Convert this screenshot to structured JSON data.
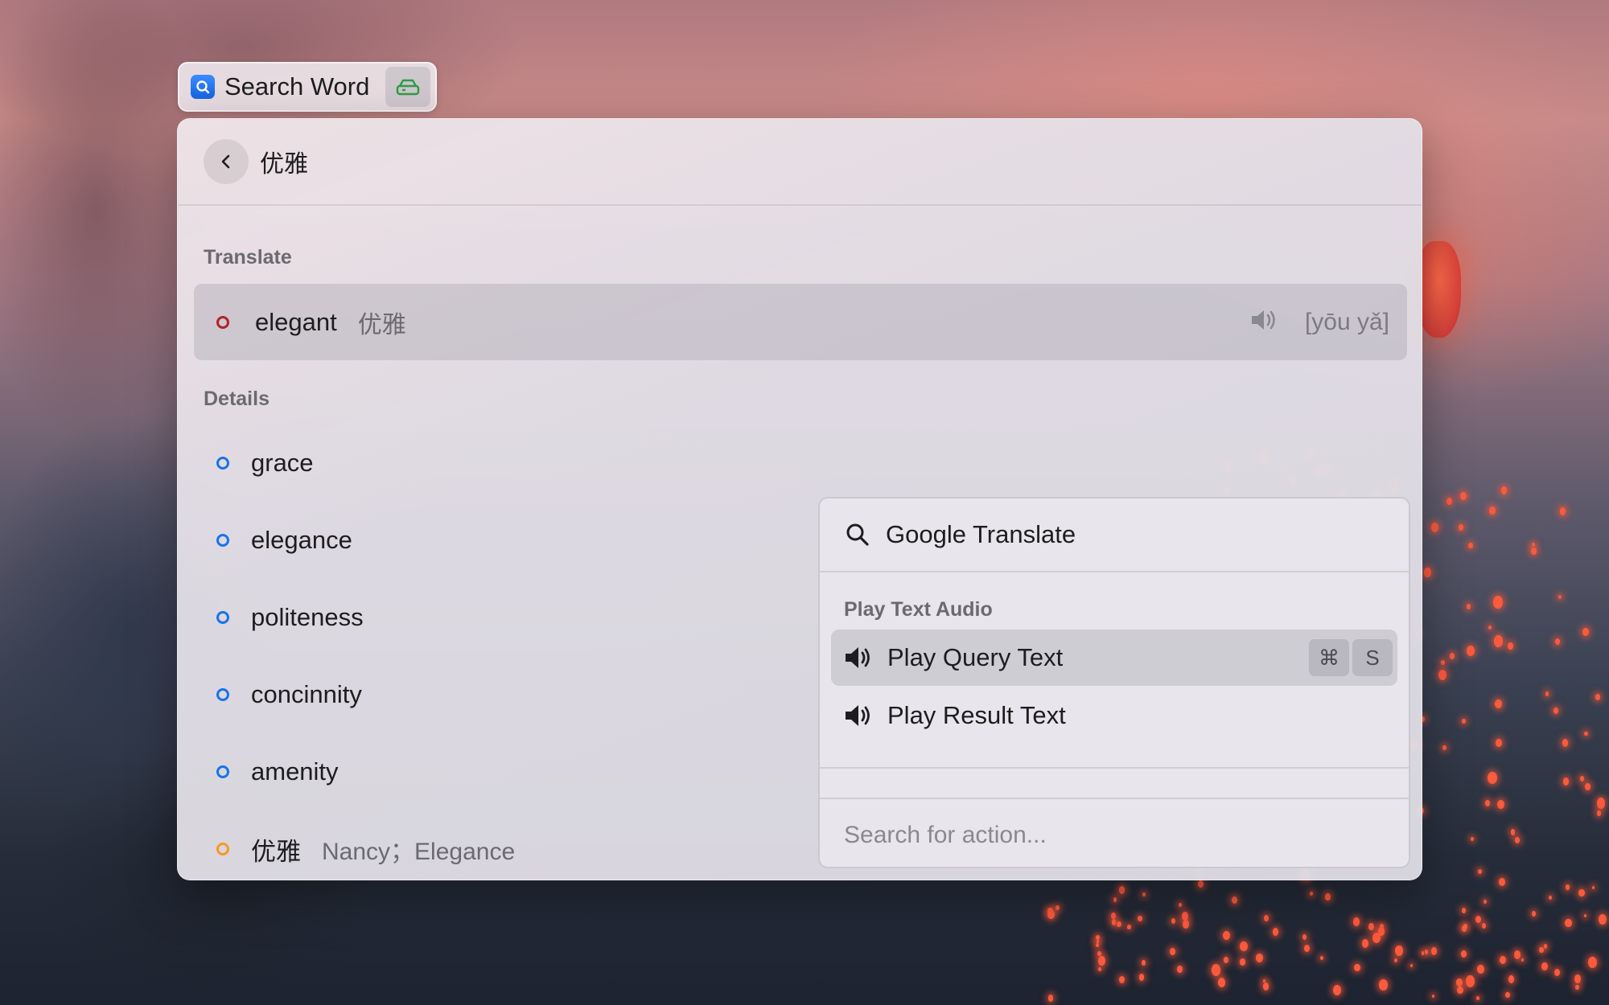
{
  "tag": {
    "app_icon": "magnifier-app-icon",
    "title": "Search Word",
    "disk_icon": "drive-icon"
  },
  "header": {
    "back_icon": "chevron-left-icon",
    "query": "优雅"
  },
  "translate": {
    "section_title": "Translate",
    "word": "elegant",
    "source": "优雅",
    "speaker_icon": "speaker-icon",
    "phonetic": "[yōu yǎ]",
    "dot_color": "#b3212a"
  },
  "details": {
    "section_title": "Details",
    "items": [
      {
        "word": "grace",
        "sub": "",
        "dot_color": "#1a73e8"
      },
      {
        "word": "elegance",
        "sub": "",
        "dot_color": "#1a73e8"
      },
      {
        "word": "politeness",
        "sub": "",
        "dot_color": "#1a73e8"
      },
      {
        "word": "concinnity",
        "sub": "",
        "dot_color": "#1a73e8"
      },
      {
        "word": "amenity",
        "sub": "",
        "dot_color": "#1a73e8"
      },
      {
        "word": "优雅",
        "sub": "Nancy；Elegance",
        "dot_color": "#f29b24"
      }
    ]
  },
  "actions": {
    "top_label": "Google Translate",
    "top_icon": "search-icon",
    "section_title": "Play Text Audio",
    "rows": [
      {
        "label": "Play Query Text",
        "icon": "speaker-icon",
        "shortcut": [
          "⌘",
          "S"
        ],
        "selected": true
      },
      {
        "label": "Play Result Text",
        "icon": "speaker-icon",
        "shortcut": [],
        "selected": false
      }
    ],
    "search_placeholder": "Search for action..."
  }
}
